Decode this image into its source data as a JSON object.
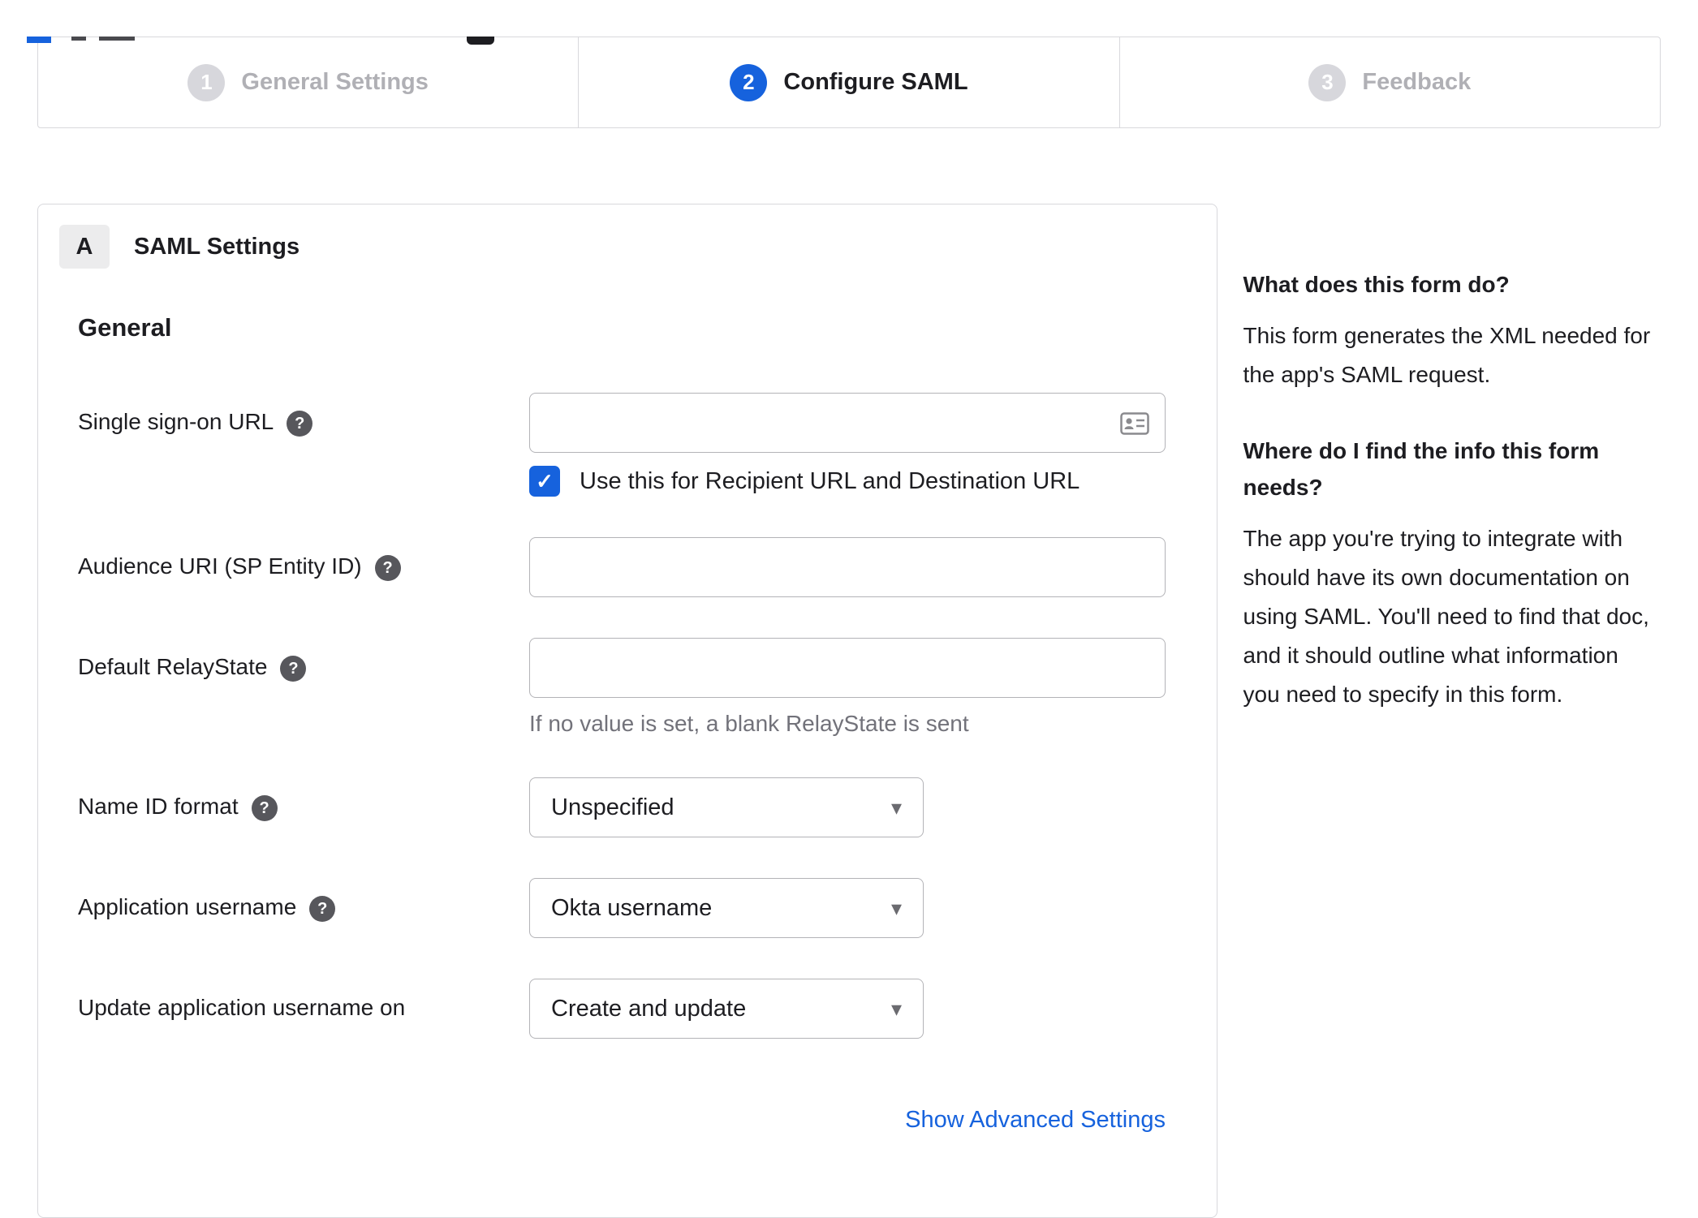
{
  "colors": {
    "accent_blue": "#1662dd",
    "link_blue": "#1662dd",
    "inactive_circle_gray": "#d7d7dc",
    "border_gray": "#d8d8dc",
    "hint_gray": "#72727a"
  },
  "icons": {
    "help_glyph": "?",
    "check_glyph": "✓",
    "caret_glyph": "▾",
    "input_trailing_icon": "contact-card-icon"
  },
  "stepper": {
    "steps": [
      {
        "number": "1",
        "label": "General Settings",
        "state": "inactive"
      },
      {
        "number": "2",
        "label": "Configure SAML",
        "state": "active"
      },
      {
        "number": "3",
        "label": "Feedback",
        "state": "inactive"
      }
    ]
  },
  "panel": {
    "badge": "A",
    "title": "SAML Settings",
    "group_title": "General",
    "fields": {
      "sso_url": {
        "label": "Single sign-on URL",
        "value": "",
        "checkbox_label": "Use this for Recipient URL and Destination URL",
        "checkbox_checked": true
      },
      "audience_uri": {
        "label": "Audience URI (SP Entity ID)",
        "value": ""
      },
      "relay_state": {
        "label": "Default RelayState",
        "value": "",
        "hint": "If no value is set, a blank RelayState is sent"
      },
      "name_id_format": {
        "label": "Name ID format",
        "value": "Unspecified"
      },
      "app_username": {
        "label": "Application username",
        "value": "Okta username"
      },
      "update_username": {
        "label": "Update application username on",
        "value": "Create and update"
      }
    },
    "advanced_link": "Show Advanced Settings"
  },
  "sidebar": {
    "q1": "What does this form do?",
    "a1": "This form generates the XML needed for the app's SAML request.",
    "q2": "Where do I find the info this form needs?",
    "a2": "The app you're trying to integrate with should have its own documentation on using SAML. You'll need to find that doc, and it should outline what information you need to specify in this form."
  }
}
